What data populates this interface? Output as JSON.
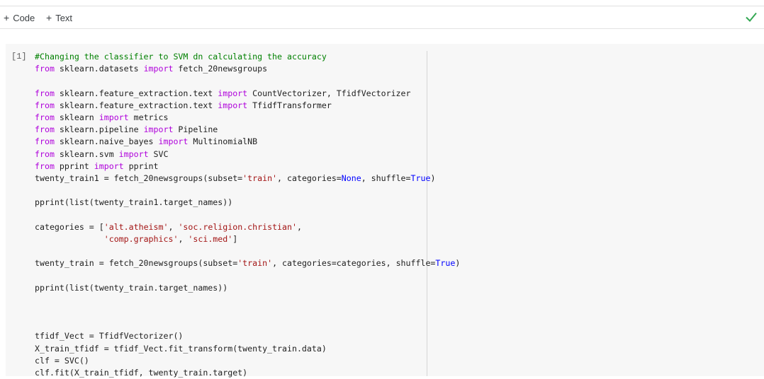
{
  "toolbar": {
    "add_code_label": "Code",
    "add_text_label": "Text"
  },
  "cell": {
    "execution_count": "[1]",
    "lines": [
      [
        [
          "cm",
          "#Changing the classifier to SVM dn calculating the accuracy"
        ]
      ],
      [
        [
          "kw",
          "from"
        ],
        [
          "",
          " sklearn.datasets "
        ],
        [
          "kw",
          "import"
        ],
        [
          "",
          " fetch_20newsgroups"
        ]
      ],
      [],
      [
        [
          "kw",
          "from"
        ],
        [
          "",
          " sklearn.feature_extraction.text "
        ],
        [
          "kw",
          "import"
        ],
        [
          "",
          " CountVectorizer, TfidfVectorizer"
        ]
      ],
      [
        [
          "kw",
          "from"
        ],
        [
          "",
          " sklearn.feature_extraction.text "
        ],
        [
          "kw",
          "import"
        ],
        [
          "",
          " TfidfTransformer"
        ]
      ],
      [
        [
          "kw",
          "from"
        ],
        [
          "",
          " sklearn "
        ],
        [
          "kw",
          "import"
        ],
        [
          "",
          " metrics"
        ]
      ],
      [
        [
          "kw",
          "from"
        ],
        [
          "",
          " sklearn.pipeline "
        ],
        [
          "kw",
          "import"
        ],
        [
          "",
          " Pipeline"
        ]
      ],
      [
        [
          "kw",
          "from"
        ],
        [
          "",
          " sklearn.naive_bayes "
        ],
        [
          "kw",
          "import"
        ],
        [
          "",
          " MultinomialNB"
        ]
      ],
      [
        [
          "kw",
          "from"
        ],
        [
          "",
          " sklearn.svm "
        ],
        [
          "kw",
          "import"
        ],
        [
          "",
          " SVC"
        ]
      ],
      [
        [
          "kw",
          "from"
        ],
        [
          "",
          " pprint "
        ],
        [
          "kw",
          "import"
        ],
        [
          "",
          " pprint"
        ]
      ],
      [
        [
          "",
          "twenty_train1 = fetch_20newsgroups(subset="
        ],
        [
          "st",
          "'train'"
        ],
        [
          "",
          ", categories="
        ],
        [
          "bi",
          "None"
        ],
        [
          "",
          ", shuffle="
        ],
        [
          "bi",
          "True"
        ],
        [
          "",
          ")"
        ]
      ],
      [],
      [
        [
          "",
          "pprint(list(twenty_train1.target_names))"
        ]
      ],
      [],
      [
        [
          "",
          "categories = ["
        ],
        [
          "st",
          "'alt.atheism'"
        ],
        [
          "",
          ", "
        ],
        [
          "st",
          "'soc.religion.christian'"
        ],
        [
          "",
          ","
        ]
      ],
      [
        [
          "",
          "              "
        ],
        [
          "st",
          "'comp.graphics'"
        ],
        [
          "",
          ", "
        ],
        [
          "st",
          "'sci.med'"
        ],
        [
          "",
          "]"
        ]
      ],
      [],
      [
        [
          "",
          "twenty_train = fetch_20newsgroups(subset="
        ],
        [
          "st",
          "'train'"
        ],
        [
          "",
          ", categories=categories, shuffle="
        ],
        [
          "bi",
          "True"
        ],
        [
          "",
          ")"
        ]
      ],
      [],
      [
        [
          "",
          "pprint(list(twenty_train.target_names))"
        ]
      ],
      [],
      [],
      [],
      [
        [
          "",
          "tfidf_Vect = TfidfVectorizer()"
        ]
      ],
      [
        [
          "",
          "X_train_tfidf = tfidf_Vect.fit_transform(twenty_train.data)"
        ]
      ],
      [
        [
          "",
          "clf = SVC()"
        ]
      ],
      [
        [
          "",
          "clf.fit(X_train_tfidf, twenty_train.target)"
        ]
      ]
    ]
  },
  "colors": {
    "keyword": "#af00db",
    "comment": "#008000",
    "string": "#a31515",
    "builtin": "#0000ff",
    "check": "#34a853"
  }
}
